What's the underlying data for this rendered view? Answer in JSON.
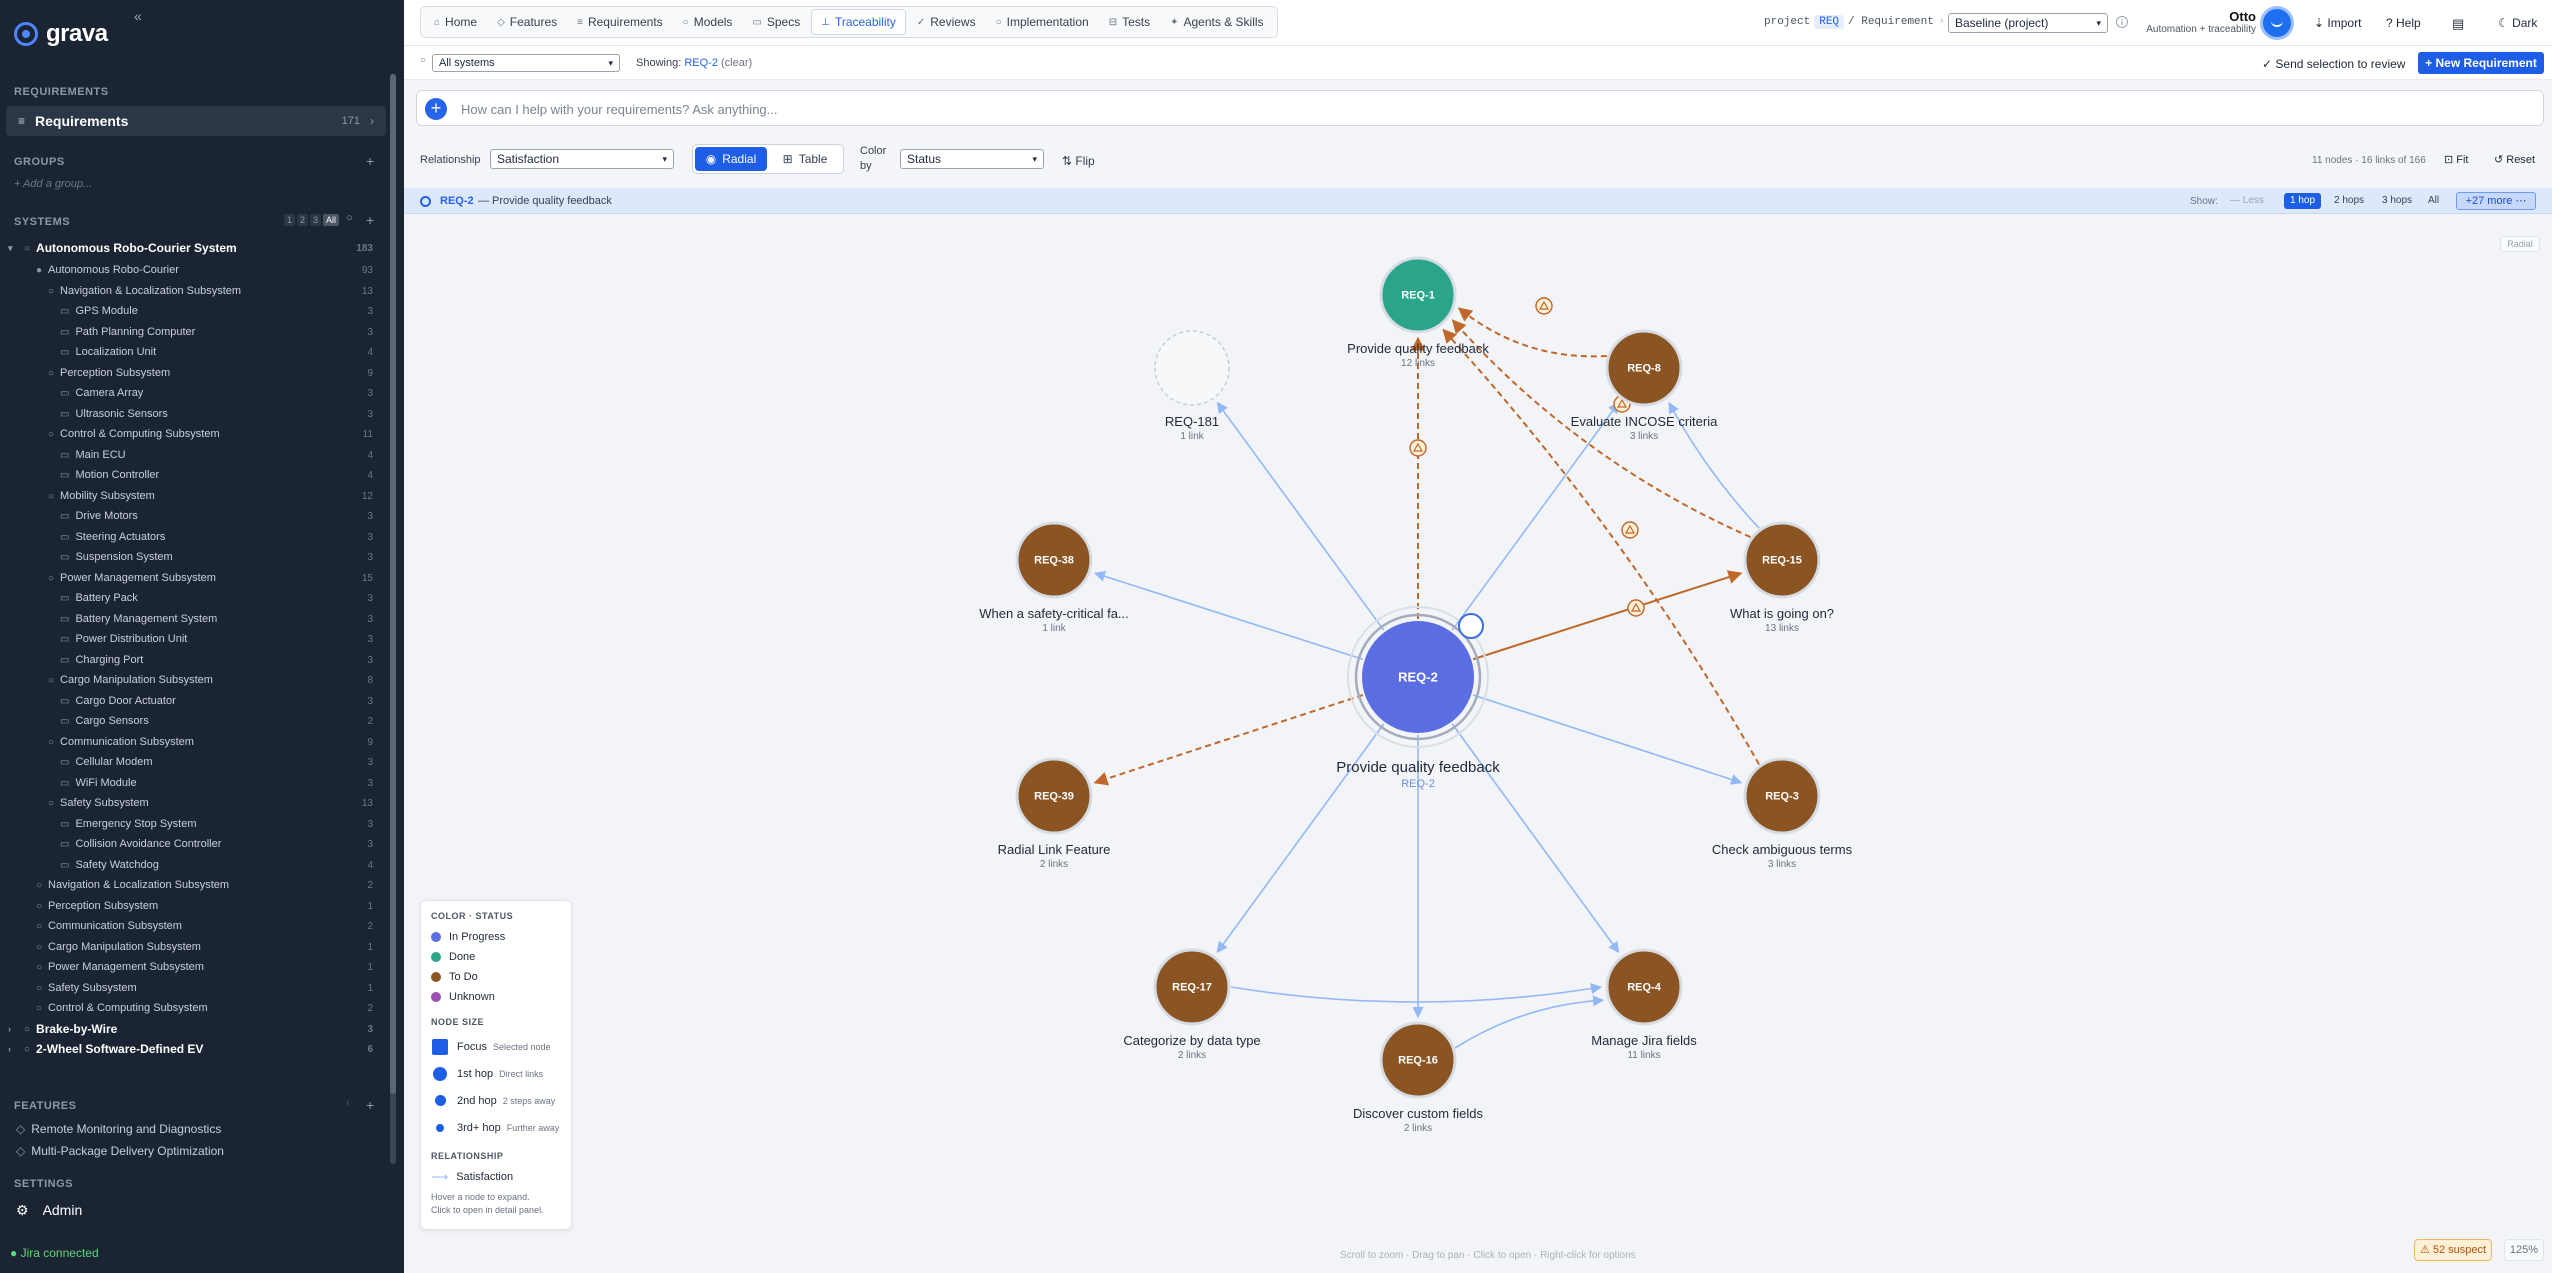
{
  "app": {
    "name": "grava",
    "collapse_glyph": "«"
  },
  "sidebar": {
    "requirements_header": "REQUIREMENTS",
    "requirements_label": "Requirements",
    "requirements_count": "171",
    "groups_header": "GROUPS",
    "add_group": "+ Add a group...",
    "systems_header": "SYSTEMS",
    "hop_buttons": [
      "1",
      "2",
      "3",
      "All"
    ],
    "tree": [
      {
        "label": "Autonomous Robo-Courier System",
        "count": "183",
        "level": 0,
        "twisty": "▾",
        "icon": "○",
        "bold": true
      },
      {
        "label": "Autonomous Robo-Courier",
        "count": "93",
        "level": 1,
        "twisty": "",
        "icon": "●",
        "bold": false
      },
      {
        "label": "Navigation & Localization Subsystem",
        "count": "13",
        "level": 2,
        "twisty": "",
        "icon": "○",
        "bold": false
      },
      {
        "label": "GPS Module",
        "count": "3",
        "level": 3,
        "twisty": "",
        "icon": "▭",
        "bold": false
      },
      {
        "label": "Path Planning Computer",
        "count": "3",
        "level": 3,
        "twisty": "",
        "icon": "▭",
        "bold": false
      },
      {
        "label": "Localization Unit",
        "count": "4",
        "level": 3,
        "twisty": "",
        "icon": "▭",
        "bold": false
      },
      {
        "label": "Perception Subsystem",
        "count": "9",
        "level": 2,
        "twisty": "",
        "icon": "○",
        "bold": false
      },
      {
        "label": "Camera Array",
        "count": "3",
        "level": 3,
        "twisty": "",
        "icon": "▭",
        "bold": false
      },
      {
        "label": "Ultrasonic Sensors",
        "count": "3",
        "level": 3,
        "twisty": "",
        "icon": "▭",
        "bold": false
      },
      {
        "label": "Control & Computing Subsystem",
        "count": "11",
        "level": 2,
        "twisty": "",
        "icon": "○",
        "bold": false
      },
      {
        "label": "Main ECU",
        "count": "4",
        "level": 3,
        "twisty": "",
        "icon": "▭",
        "bold": false
      },
      {
        "label": "Motion Controller",
        "count": "4",
        "level": 3,
        "twisty": "",
        "icon": "▭",
        "bold": false
      },
      {
        "label": "Mobility Subsystem",
        "count": "12",
        "level": 2,
        "twisty": "",
        "icon": "○",
        "bold": false
      },
      {
        "label": "Drive Motors",
        "count": "3",
        "level": 3,
        "twisty": "",
        "icon": "▭",
        "bold": false
      },
      {
        "label": "Steering Actuators",
        "count": "3",
        "level": 3,
        "twisty": "",
        "icon": "▭",
        "bold": false
      },
      {
        "label": "Suspension System",
        "count": "3",
        "level": 3,
        "twisty": "",
        "icon": "▭",
        "bold": false
      },
      {
        "label": "Power Management Subsystem",
        "count": "15",
        "level": 2,
        "twisty": "",
        "icon": "○",
        "bold": false
      },
      {
        "label": "Battery Pack",
        "count": "3",
        "level": 3,
        "twisty": "",
        "icon": "▭",
        "bold": false
      },
      {
        "label": "Battery Management System",
        "count": "3",
        "level": 3,
        "twisty": "",
        "icon": "▭",
        "bold": false
      },
      {
        "label": "Power Distribution Unit",
        "count": "3",
        "level": 3,
        "twisty": "",
        "icon": "▭",
        "bold": false
      },
      {
        "label": "Charging Port",
        "count": "3",
        "level": 3,
        "twisty": "",
        "icon": "▭",
        "bold": false
      },
      {
        "label": "Cargo Manipulation Subsystem",
        "count": "8",
        "level": 2,
        "twisty": "",
        "icon": "○",
        "bold": false
      },
      {
        "label": "Cargo Door Actuator",
        "count": "3",
        "level": 3,
        "twisty": "",
        "icon": "▭",
        "bold": false
      },
      {
        "label": "Cargo Sensors",
        "count": "2",
        "level": 3,
        "twisty": "",
        "icon": "▭",
        "bold": false
      },
      {
        "label": "Communication Subsystem",
        "count": "9",
        "level": 2,
        "twisty": "",
        "icon": "○",
        "bold": false
      },
      {
        "label": "Cellular Modem",
        "count": "3",
        "level": 3,
        "twisty": "",
        "icon": "▭",
        "bold": false
      },
      {
        "label": "WiFi Module",
        "count": "3",
        "level": 3,
        "twisty": "",
        "icon": "▭",
        "bold": false
      },
      {
        "label": "Safety Subsystem",
        "count": "13",
        "level": 2,
        "twisty": "",
        "icon": "○",
        "bold": false
      },
      {
        "label": "Emergency Stop System",
        "count": "3",
        "level": 3,
        "twisty": "",
        "icon": "▭",
        "bold": false
      },
      {
        "label": "Collision Avoidance Controller",
        "count": "3",
        "level": 3,
        "twisty": "",
        "icon": "▭",
        "bold": false
      },
      {
        "label": "Safety Watchdog",
        "count": "4",
        "level": 3,
        "twisty": "",
        "icon": "▭",
        "bold": false
      },
      {
        "label": "Navigation & Localization Subsystem",
        "count": "2",
        "level": 1,
        "twisty": "",
        "icon": "○",
        "bold": false
      },
      {
        "label": "Perception Subsystem",
        "count": "1",
        "level": 1,
        "twisty": "",
        "icon": "○",
        "bold": false
      },
      {
        "label": "Communication Subsystem",
        "count": "2",
        "level": 1,
        "twisty": "",
        "icon": "○",
        "bold": false
      },
      {
        "label": "Cargo Manipulation Subsystem",
        "count": "1",
        "level": 1,
        "twisty": "",
        "icon": "○",
        "bold": false
      },
      {
        "label": "Power Management Subsystem",
        "count": "1",
        "level": 1,
        "twisty": "",
        "icon": "○",
        "bold": false
      },
      {
        "label": "Safety Subsystem",
        "count": "1",
        "level": 1,
        "twisty": "",
        "icon": "○",
        "bold": false
      },
      {
        "label": "Control & Computing Subsystem",
        "count": "2",
        "level": 1,
        "twisty": "",
        "icon": "○",
        "bold": false
      },
      {
        "label": "Brake-by-Wire",
        "count": "3",
        "level": 0,
        "twisty": "›",
        "icon": "○",
        "bold": true
      },
      {
        "label": "2-Wheel Software-Defined EV",
        "count": "6",
        "level": 0,
        "twisty": "›",
        "icon": "○",
        "bold": true
      }
    ],
    "features_header": "FEATURES",
    "features": [
      "Remote Monitoring and Diagnostics",
      "Multi-Package Delivery Optimization"
    ],
    "settings_header": "SETTINGS",
    "admin_label": "Admin",
    "jira_status": "● Jira connected"
  },
  "nav": {
    "tabs": [
      {
        "label": "Home",
        "icon": "⌂",
        "active": false
      },
      {
        "label": "Features",
        "icon": "◇",
        "active": false
      },
      {
        "label": "Requirements",
        "icon": "≡",
        "active": false
      },
      {
        "label": "Models",
        "icon": "○",
        "active": false
      },
      {
        "label": "Specs",
        "icon": "▭",
        "active": false
      },
      {
        "label": "Traceability",
        "icon": "⊥",
        "active": true
      },
      {
        "label": "Reviews",
        "icon": "✓",
        "active": false
      },
      {
        "label": "Implementation",
        "icon": "○",
        "active": false
      },
      {
        "label": "Tests",
        "icon": "⊟",
        "active": false
      },
      {
        "label": "Agents & Skills",
        "icon": "✦",
        "active": false
      }
    ],
    "crumb_prefix": "project",
    "crumb_project": "REQ",
    "crumb_suffix": "/ Requirement",
    "baseline": "Baseline (project)",
    "user_name": "Otto",
    "user_role": "Automation + traceability",
    "import": "⇣ Import",
    "help": "? Help",
    "dark": "☾ Dark"
  },
  "toolbar": {
    "systems_select": "All systems",
    "showing_label": "Showing:",
    "showing_id": "REQ-2",
    "clear": "(clear)",
    "send_selection": "✓ Send selection to review",
    "new_requirement": "+ New Requirement",
    "prompt_placeholder": "How can I help with your requirements? Ask anything..."
  },
  "controls": {
    "relationship_label": "Relationship",
    "relationship_value": "Satisfaction",
    "radial": "Radial",
    "table": "Table",
    "color_by_label": "Color by",
    "color_by_value": "Status",
    "flip": "⇅ Flip",
    "node_count": "11 nodes · 16 links of 166",
    "fit": "⊡ Fit",
    "reset": "↺ Reset"
  },
  "focus": {
    "id": "REQ-2",
    "title": "— Provide quality feedback",
    "show_label": "Show:",
    "less": "— Less",
    "hops": [
      "1 hop",
      "2 hops",
      "3 hops",
      "All"
    ],
    "active_hop": "1 hop",
    "more": "+27 more ⋯"
  },
  "colors": {
    "in_progress": "#5b6ee1",
    "done": "#2aa58a",
    "todo": "#8b5423",
    "unknown": "#9b4fb0",
    "link": "#93b8f5",
    "suspect": "#c0672a"
  },
  "graph": {
    "focus": {
      "id": "REQ-2",
      "title": "Provide quality feedback",
      "sub": "REQ-2",
      "status": "in_progress"
    },
    "nodes": [
      {
        "id": "REQ-1",
        "title": "Provide quality feedback",
        "links": "12 links",
        "status": "done"
      },
      {
        "id": "REQ-8",
        "title": "Evaluate INCOSE criteria",
        "links": "3 links",
        "status": "todo"
      },
      {
        "id": "REQ-15",
        "title": "What is going on?",
        "links": "13 links",
        "status": "todo"
      },
      {
        "id": "REQ-3",
        "title": "Check ambiguous terms",
        "links": "3 links",
        "status": "todo"
      },
      {
        "id": "REQ-4",
        "title": "Manage Jira fields",
        "links": "11 links",
        "status": "todo"
      },
      {
        "id": "REQ-16",
        "title": "Discover custom fields",
        "links": "2 links",
        "status": "todo"
      },
      {
        "id": "REQ-17",
        "title": "Categorize by data type",
        "links": "2 links",
        "status": "todo"
      },
      {
        "id": "REQ-39",
        "title": "Radial Link Feature",
        "links": "2 links",
        "status": "todo"
      },
      {
        "id": "REQ-38",
        "title": "When a safety-critical fa...",
        "links": "1 link",
        "status": "todo"
      },
      {
        "id": "REQ-181",
        "title": "REQ-181",
        "links": "1 link",
        "status": "unknown_placeholder"
      }
    ]
  },
  "legend": {
    "color_header": "COLOR · STATUS",
    "statuses": [
      {
        "label": "In Progress",
        "key": "in_progress"
      },
      {
        "label": "Done",
        "key": "done"
      },
      {
        "label": "To Do",
        "key": "todo"
      },
      {
        "label": "Unknown",
        "key": "unknown"
      }
    ],
    "size_header": "NODE SIZE",
    "sizes": [
      {
        "label": "Focus",
        "sub": "Selected node"
      },
      {
        "label": "1st hop",
        "sub": "Direct links"
      },
      {
        "label": "2nd hop",
        "sub": "2 steps away"
      },
      {
        "label": "3rd+ hop",
        "sub": "Further away"
      }
    ],
    "rel_header": "RELATIONSHIP",
    "rel_label": "Satisfaction",
    "hint1": "Hover a node to expand.",
    "hint2": "Click to open in detail panel."
  },
  "footer": {
    "hint": "Scroll to zoom · Drag to pan · Click to open · Right-click for options",
    "suspect": "⚠ 52 suspect",
    "zoom": "125%",
    "radial_badge": "Radial"
  }
}
